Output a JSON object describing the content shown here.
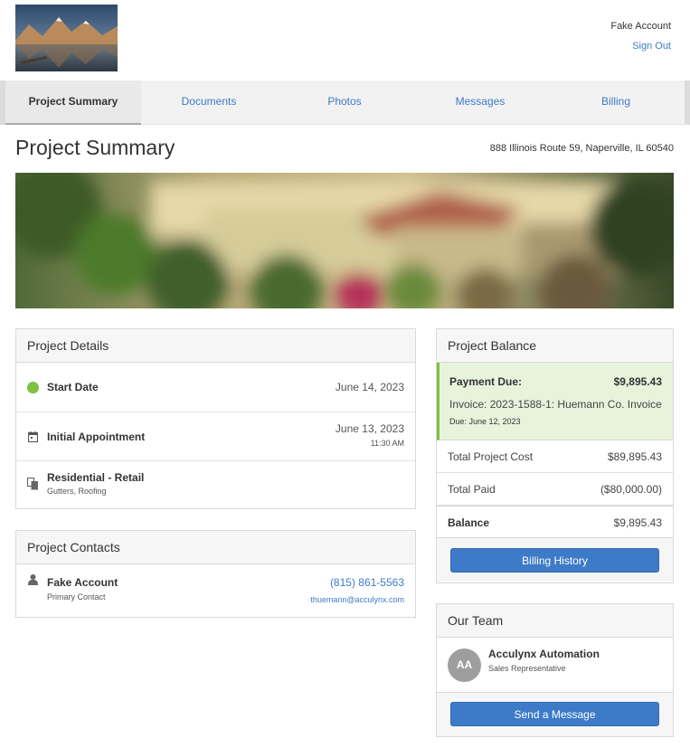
{
  "header": {
    "account_name": "Fake Account",
    "sign_out": "Sign Out"
  },
  "tabs": [
    {
      "label": "Project Summary",
      "active": true
    },
    {
      "label": "Documents",
      "active": false
    },
    {
      "label": "Photos",
      "active": false
    },
    {
      "label": "Messages",
      "active": false
    },
    {
      "label": "Billing",
      "active": false
    }
  ],
  "page": {
    "title": "Project Summary",
    "address": "888 Illinois Route 59, Naperville, IL 60540"
  },
  "project_details": {
    "title": "Project Details",
    "start": {
      "label": "Start Date",
      "date": "June 14, 2023"
    },
    "appointment": {
      "label": "Initial Appointment",
      "date": "June 13, 2023",
      "time": "11:30 AM"
    },
    "type": {
      "label": "Residential - Retail",
      "sub": "Gutters, Roofing"
    }
  },
  "project_contacts": {
    "title": "Project Contacts",
    "name": "Fake Account",
    "role": "Primary Contact",
    "phone": "(815) 861-5563",
    "email": "thuemann@acculynx.com"
  },
  "balance": {
    "title": "Project Balance",
    "payment_due_label": "Payment Due:",
    "payment_due_amount": "$9,895.43",
    "invoice": "Invoice: 2023-1588-1: Huemann Co. Invoice",
    "due": "Due: June 12, 2023",
    "total_cost_label": "Total Project Cost",
    "total_cost": "$89,895.43",
    "total_paid_label": "Total Paid",
    "total_paid": "($80,000.00)",
    "balance_label": "Balance",
    "balance": "$9,895.43",
    "history_button": "Billing History"
  },
  "team": {
    "title": "Our Team",
    "initials": "AA",
    "name": "Acculynx Automation",
    "role": "Sales Representative",
    "message_button": "Send a Message"
  },
  "colors": {
    "accent": "#3d7bc8",
    "status_green": "#7cc242",
    "due_bg": "#e8f3dc"
  }
}
